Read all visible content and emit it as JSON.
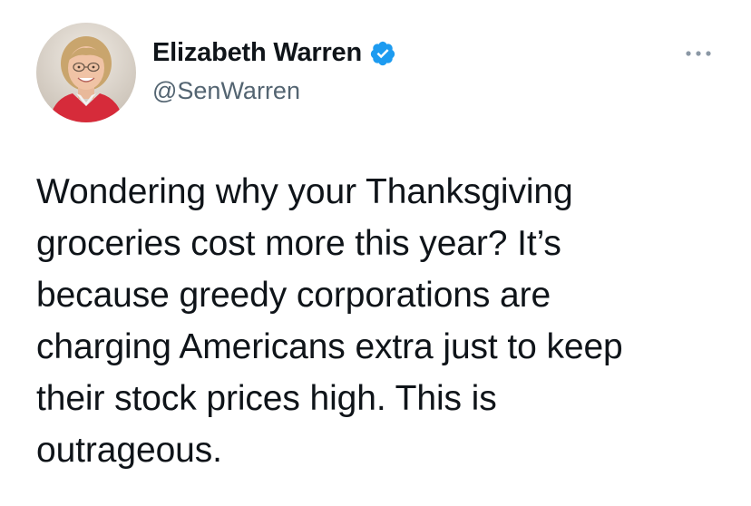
{
  "author": {
    "display_name": "Elizabeth Warren",
    "handle": "@SenWarren",
    "verified": true,
    "avatar_icon": "profile-photo"
  },
  "menu": {
    "icon": "more-options-icon"
  },
  "tweet": {
    "text": "Wondering why your Thanksgiving\ngroceries cost more this year? It’s\nbecause greedy corporations are\ncharging Americans extra just to keep\ntheir stock prices high. This is\noutrageous."
  },
  "colors": {
    "text_primary": "#0f1419",
    "text_secondary": "#536471",
    "verified_blue": "#1d9bf0",
    "more_icon": "#8b98a5"
  }
}
